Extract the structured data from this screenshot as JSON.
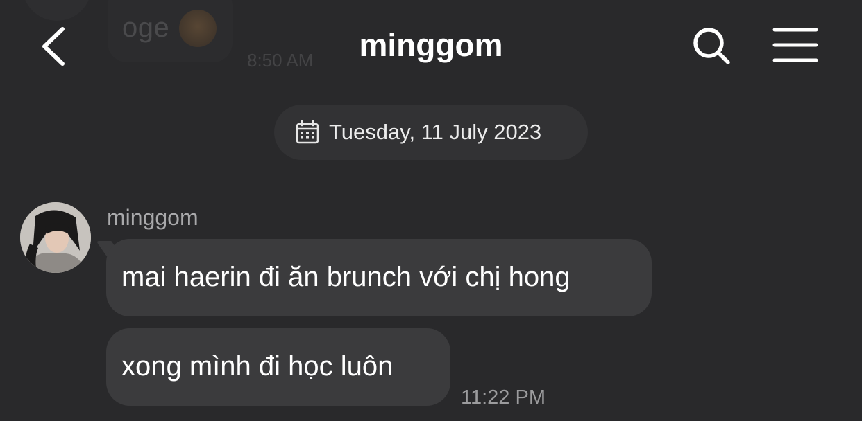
{
  "header": {
    "title": "minggom",
    "back_icon": "chevron-left-icon",
    "search_icon": "search-icon",
    "menu_icon": "menu-icon"
  },
  "previous_message": {
    "text": "oge",
    "time": "8:50 AM"
  },
  "date_divider": {
    "icon": "calendar-icon",
    "label": "Tuesday, 11 July 2023"
  },
  "conversation": {
    "sender": "minggom",
    "messages": [
      {
        "text": "mai haerin đi ăn brunch với chị hong"
      },
      {
        "text": "xong mình đi học luôn"
      }
    ],
    "time": "11:22 PM"
  },
  "colors": {
    "background": "#29292b",
    "bubble": "#3b3b3d",
    "date_pill": "#323234",
    "text": "#ffffff",
    "muted_text": "#9b9b9d"
  }
}
